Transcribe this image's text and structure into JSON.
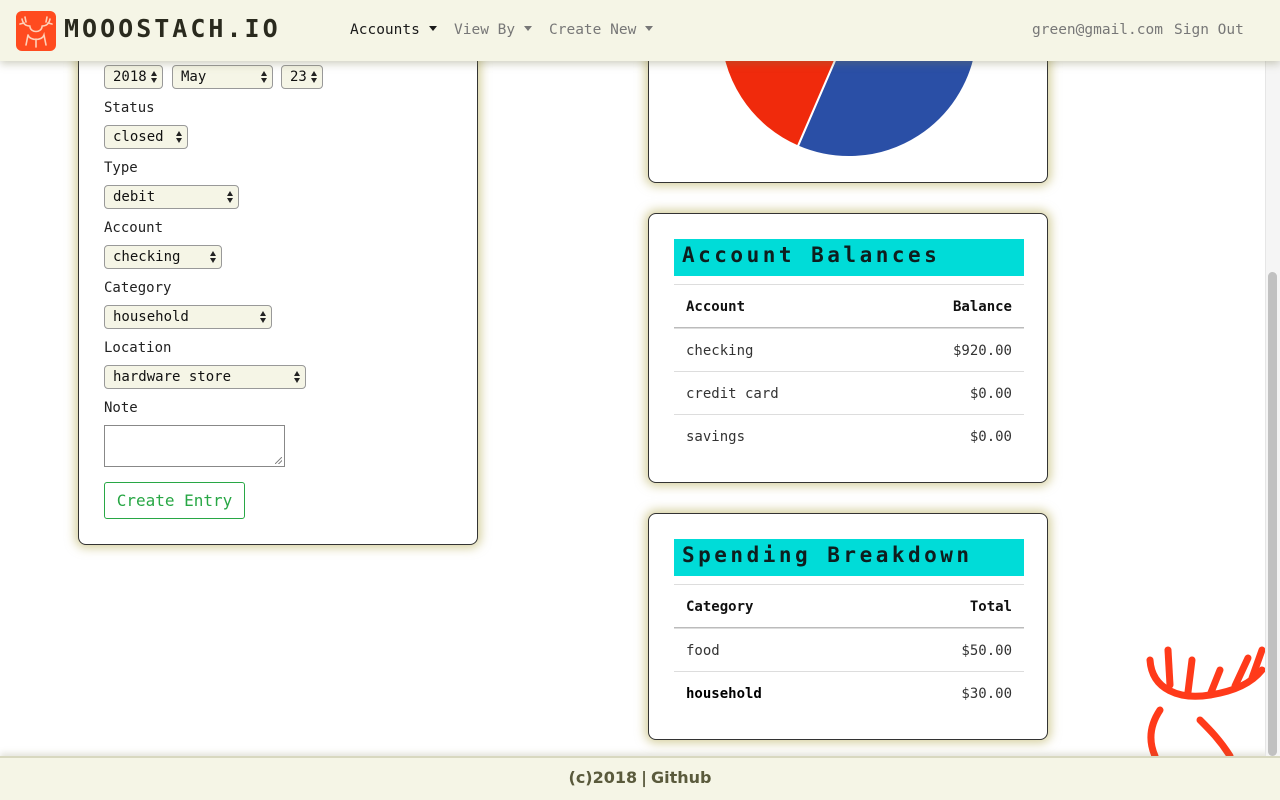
{
  "colors": {
    "accent_cyan": "#00dcd8",
    "brand_orange": "#ff4b1f",
    "success_green": "#28a745",
    "pie_blue": "#2a4fa6",
    "pie_red": "#f02a0c",
    "nav_bg": "#f5f5e6"
  },
  "navbar": {
    "brand": "MOOOSTACH.IO",
    "brand_icon": "moose-logo-icon",
    "menu": [
      {
        "label": "Accounts",
        "active": true
      },
      {
        "label": "View By",
        "active": false
      },
      {
        "label": "Create New",
        "active": false
      }
    ],
    "user_email": "green@gmail.com",
    "sign_out": "Sign Out"
  },
  "entry_form": {
    "date": {
      "year": "2018",
      "month": "May",
      "day": "23"
    },
    "status": {
      "label": "Status",
      "value": "closed"
    },
    "type": {
      "label": "Type",
      "value": "debit"
    },
    "account": {
      "label": "Account",
      "value": "checking"
    },
    "category": {
      "label": "Category",
      "value": "household"
    },
    "location": {
      "label": "Location",
      "value": "hardware store"
    },
    "note": {
      "label": "Note",
      "value": ""
    },
    "submit_label": "Create Entry"
  },
  "pie_chart": {
    "slices": [
      {
        "name": "food",
        "value": 50,
        "color": "#2a4fa6"
      },
      {
        "name": "household",
        "value": 30,
        "color": "#f02a0c"
      }
    ]
  },
  "account_balances": {
    "title": "Account Balances",
    "headers": {
      "account": "Account",
      "balance": "Balance"
    },
    "rows": [
      {
        "account": "checking",
        "balance": "$920.00"
      },
      {
        "account": "credit card",
        "balance": "$0.00"
      },
      {
        "account": "savings",
        "balance": "$0.00"
      }
    ]
  },
  "spending_breakdown": {
    "title": "Spending Breakdown",
    "headers": {
      "category": "Category",
      "total": "Total"
    },
    "rows": [
      {
        "category": "food",
        "total": "$50.00",
        "bold": false
      },
      {
        "category": "household",
        "total": "$30.00",
        "bold": true
      }
    ]
  },
  "footer": {
    "copyright": "(c)2018",
    "separator": "|",
    "link": "Github"
  }
}
